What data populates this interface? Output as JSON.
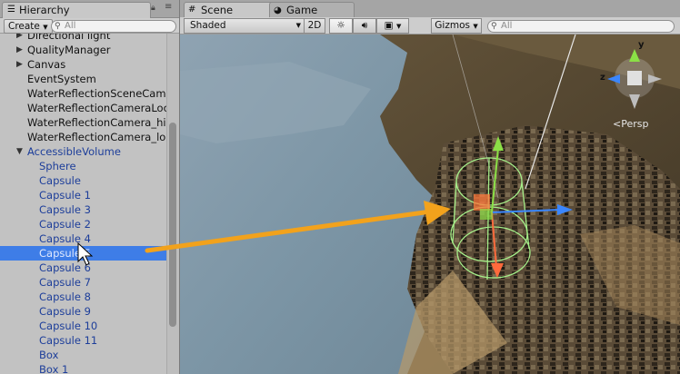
{
  "hierarchy": {
    "tab_label": "Hierarchy",
    "create_label": "Create",
    "search_placeholder": "All",
    "items": [
      {
        "label": "Directional light",
        "indent": 0,
        "arrow": "▶",
        "color": "#111111"
      },
      {
        "label": "QualityManager",
        "indent": 0,
        "arrow": "▶",
        "color": "#111111"
      },
      {
        "label": "Canvas",
        "indent": 0,
        "arrow": "▶",
        "color": "#111111"
      },
      {
        "label": "EventSystem",
        "indent": 0,
        "arrow": "",
        "color": "#111111"
      },
      {
        "label": "WaterReflectionSceneCam",
        "indent": 0,
        "arrow": "",
        "color": "#111111"
      },
      {
        "label": "WaterReflectionCameraLoc",
        "indent": 0,
        "arrow": "",
        "color": "#111111"
      },
      {
        "label": "WaterReflectionCamera_hi",
        "indent": 0,
        "arrow": "",
        "color": "#111111"
      },
      {
        "label": "WaterReflectionCamera_lo",
        "indent": 0,
        "arrow": "",
        "color": "#111111"
      },
      {
        "label": "AccessibleVolume",
        "indent": 0,
        "arrow": "▼",
        "color": "#1d3e9a"
      },
      {
        "label": "Sphere",
        "indent": 1,
        "arrow": "",
        "color": "#1d3e9a"
      },
      {
        "label": "Capsule",
        "indent": 1,
        "arrow": "",
        "color": "#1d3e9a"
      },
      {
        "label": "Capsule 1",
        "indent": 1,
        "arrow": "",
        "color": "#1d3e9a"
      },
      {
        "label": "Capsule 3",
        "indent": 1,
        "arrow": "",
        "color": "#1d3e9a"
      },
      {
        "label": "Capsule 2",
        "indent": 1,
        "arrow": "",
        "color": "#1d3e9a"
      },
      {
        "label": "Capsule 4",
        "indent": 1,
        "arrow": "",
        "color": "#1d3e9a"
      },
      {
        "label": "Capsule 5",
        "indent": 1,
        "arrow": "",
        "color": "#1d3e9a",
        "selected": true
      },
      {
        "label": "Capsule 6",
        "indent": 1,
        "arrow": "",
        "color": "#1d3e9a"
      },
      {
        "label": "Capsule 7",
        "indent": 1,
        "arrow": "",
        "color": "#1d3e9a"
      },
      {
        "label": "Capsule 8",
        "indent": 1,
        "arrow": "",
        "color": "#1d3e9a"
      },
      {
        "label": "Capsule 9",
        "indent": 1,
        "arrow": "",
        "color": "#1d3e9a"
      },
      {
        "label": "Capsule 10",
        "indent": 1,
        "arrow": "",
        "color": "#1d3e9a"
      },
      {
        "label": "Capsule 11",
        "indent": 1,
        "arrow": "",
        "color": "#1d3e9a"
      },
      {
        "label": "Box",
        "indent": 1,
        "arrow": "",
        "color": "#1d3e9a"
      },
      {
        "label": "Box 1",
        "indent": 1,
        "arrow": "",
        "color": "#1d3e9a"
      }
    ]
  },
  "scene": {
    "tab_scene": "Scene",
    "tab_game": "Game",
    "shading_mode": "Shaded",
    "mode_2d": "2D",
    "gizmos_label": "Gizmos",
    "search_placeholder": "All",
    "persp_label": "Persp",
    "axis_y": "y",
    "axis_z": "z"
  },
  "colors": {
    "selection": "#3e7de7",
    "annotation_arrow": "#f2a21c"
  }
}
